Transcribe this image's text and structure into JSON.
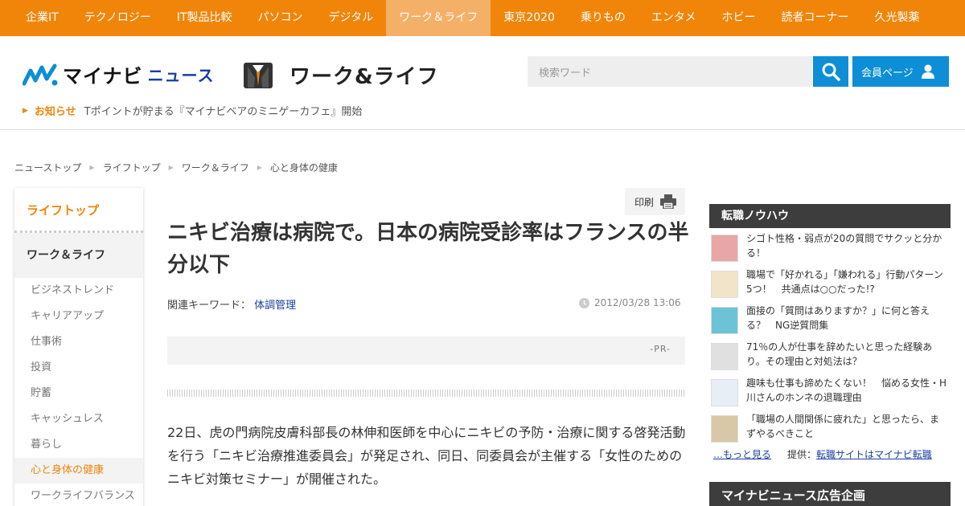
{
  "topnav": {
    "items": [
      "企業IT",
      "テクノロジー",
      "IT製品比較",
      "パソコン",
      "デジタル",
      "ワーク＆ライフ",
      "東京2020",
      "乗りもの",
      "エンタメ",
      "ホビー",
      "読者コーナー",
      "久光製薬"
    ],
    "active_index": 5
  },
  "header": {
    "logo_main": "マイナビ",
    "logo_sub": "ニュース",
    "section_title": "ワーク&ライフ",
    "search_placeholder": "検索ワード",
    "member_label": "会員ページ",
    "notice_label": "お知らせ",
    "notice_text": "Tポイントが貯まる『マイナビベアのミニゲーカフェ』開始"
  },
  "breadcrumb": [
    "ニューストップ",
    "ライフトップ",
    "ワーク＆ライフ",
    "心と身体の健康"
  ],
  "sidebar": {
    "top_label": "ライフトップ",
    "section_label": "ワーク＆ライフ",
    "items": [
      "ビジネストレンド",
      "キャリアアップ",
      "仕事術",
      "投資",
      "貯蓄",
      "キャッシュレス",
      "暮らし",
      "心と身体の健康",
      "ワークライフバランス"
    ],
    "active_index": 7
  },
  "article": {
    "print_label": "印刷",
    "title": "ニキビ治療は病院で。日本の病院受診率はフランスの半分以下",
    "keywords_label": "関連キーワード：",
    "keyword": "体調管理",
    "timestamp": "2012/03/28 13:06",
    "pr_label": "-PR-",
    "body": "22日、虎の門病院皮膚科部長の林伸和医師を中心にニキビの予防・治療に関する啓発活動を行う「ニキビ治療推進委員会」が発足され、同日、同委員会が主催する「女性のためのニキビ対策セミナー」が開催された。"
  },
  "right_column": {
    "heading": "転職ノウハウ",
    "items": [
      {
        "text": "シゴト性格・弱点が20の質問でサクッと分かる！",
        "thumb_color": "#e8a6a6"
      },
      {
        "text": "職場で「好かれる」「嫌われる」行動パターン5つ！　共通点は○○だった!?",
        "thumb_color": "#f2e4c8"
      },
      {
        "text": "面接の「質問はありますか？」に何と答える？　NG逆質問集",
        "thumb_color": "#6cc3d6"
      },
      {
        "text": "71％の人が仕事を辞めたいと思った経験あり。その理由と対処法は？",
        "thumb_color": "#e0e0e0"
      },
      {
        "text": "趣味も仕事も諦めたくない！　悩める女性・H川さんのホンネの退職理由",
        "thumb_color": "#e8eef6"
      },
      {
        "text": "「職場の人間関係に疲れた」と思ったら、まずやるべきこと",
        "thumb_color": "#d8c8a8"
      }
    ],
    "more_label": "…もっと見る",
    "provider_label": "提供：",
    "provider_link": "転職サイトはマイナビ転職",
    "heading2": "マイナビニュース広告企画"
  },
  "colors": {
    "brand_orange": "#f0850a",
    "brand_blue": "#0d8ed6",
    "dark_heading": "#3d3d3d"
  }
}
